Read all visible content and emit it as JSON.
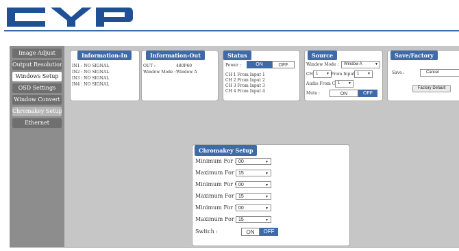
{
  "brand": {
    "logo_text": "CYP",
    "accent": "#3f6aa8"
  },
  "sidebar": {
    "items": [
      {
        "label": "Image Adjust"
      },
      {
        "label": "Output Resolution"
      },
      {
        "label": "Windows Setup"
      },
      {
        "label": "OSD Settings"
      },
      {
        "label": "Window Convert"
      },
      {
        "label": "Chromakey Setup"
      },
      {
        "label": "Ethernet"
      }
    ],
    "active": "Windows Setup"
  },
  "info_in": {
    "title": "Information-In",
    "lines": [
      "IN1 : NO SIGNAL",
      "IN2 : NO SIGNAL",
      "IN3 : NO SIGNAL",
      "IN4 : NO SIGNAL"
    ]
  },
  "info_out": {
    "title": "Information-Out",
    "out_label": "OUT :",
    "out_value": "480P60",
    "window_mode_label": "Window Mode :",
    "window_mode_value": "Window A"
  },
  "status": {
    "title": "Status",
    "power_label": "Power :",
    "on": "ON",
    "off": "OFF",
    "channels": [
      "CH 1 From Input   1",
      "CH 2 From Input   2",
      "CH 3 From Input   3",
      "CH 4 From Input   4"
    ]
  },
  "source": {
    "title": "Source",
    "window_mode_label": "Window Mode :",
    "window_mode_value": "Window A",
    "ch_label": "CH",
    "ch_value": "1",
    "from_input_label": "From Input",
    "from_input_value": "1",
    "audio_label": "Audio From CH",
    "audio_value": "1",
    "mute_label": "Mute :",
    "on": "ON",
    "off": "OFF"
  },
  "save_factory": {
    "title": "Save/Factory",
    "save_label": "Save :",
    "save_value": "Cancel",
    "factory_button": "Factory Default"
  },
  "chromakey": {
    "title": "Chromakey Setup",
    "rows": [
      {
        "label": "Minimum For R :",
        "value": "00"
      },
      {
        "label": "Maximum For R :",
        "value": "15"
      },
      {
        "label": "Minimum For G :",
        "value": "00"
      },
      {
        "label": "Maximum For G :",
        "value": "15"
      },
      {
        "label": "Minimum For B :",
        "value": "00"
      },
      {
        "label": "Maximum For B :",
        "value": "15"
      }
    ],
    "switch_label": "Switch :",
    "on": "ON",
    "off": "OFF"
  }
}
